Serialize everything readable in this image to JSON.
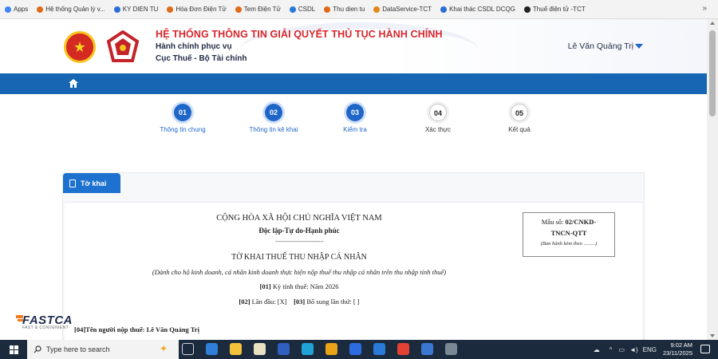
{
  "bookmarks_bar": {
    "items": [
      {
        "label": "Apps",
        "color": "#4285f4"
      },
      {
        "label": "Hệ thống Quản lý v...",
        "color": "#e06a1b"
      },
      {
        "label": "KY DIEN TU",
        "color": "#2a6fd6"
      },
      {
        "label": "Hóa Đơn Điện Tử",
        "color": "#e06a1b"
      },
      {
        "label": "Tem Điện Tử",
        "color": "#e06a1b"
      },
      {
        "label": "CSDL",
        "color": "#2a7bd6"
      },
      {
        "label": "Thu dien tu",
        "color": "#e06a1b"
      },
      {
        "label": "DataService-TCT",
        "color": "#e0881b"
      },
      {
        "label": "Khai thác CSDL DCQG",
        "color": "#2a6fd6"
      },
      {
        "label": "Thuế điện tử -TCT",
        "color": "#222222"
      }
    ],
    "more": "»"
  },
  "header": {
    "title": "HỆ THỐNG THÔNG TIN GIẢI QUYẾT THỦ TỤC HÀNH CHÍNH",
    "subtitle1": "Hành chính phục vụ",
    "subtitle2": "Cục Thuế - Bộ Tài chính",
    "user_name": "Lê Văn Quảng Trị",
    "emblem_glyph": "★"
  },
  "nav": {
    "home_icon": "home-icon"
  },
  "stepper": {
    "steps": [
      {
        "num": "01",
        "label": "Thông tin chung",
        "state": "done"
      },
      {
        "num": "02",
        "label": "Thông tin kê khai",
        "state": "done"
      },
      {
        "num": "03",
        "label": "Kiểm tra",
        "state": "done"
      },
      {
        "num": "04",
        "label": "Xác thực",
        "state": "todo"
      },
      {
        "num": "05",
        "label": "Kết quả",
        "state": "todo"
      }
    ]
  },
  "form": {
    "tab_label": "Tờ khai",
    "nation": "CỘNG HÒA XÃ HỘI CHỦ NGHĨA VIỆT NAM",
    "motto": "Độc lập-Tự do-Hạnh phúc",
    "divider": "----------------------------",
    "form_title": "TỜ KHAI THUẾ THU NHẬP CÁ NHÂN",
    "form_note": "(Dành cho hộ kinh doanh, cá nhân kinh doanh thực hiện nộp thuế thu nhập cá nhân trên thu nhập tính thuế)",
    "field01_code": "[01]",
    "field01_text": "Kỳ tính thuế: Năm 2026",
    "field02_code": "[02]",
    "field02_text": "Lần đầu: [X]",
    "field03_code": "[03]",
    "field03_text": "Bổ sung lần thứ: [ ]",
    "field04_code": "[04]",
    "field04_text": "Tên người nộp thuế: Lê Văn Quảng Trị",
    "mau_prefix": "Mẫu số:",
    "mau_code1": "02/CNKD-",
    "mau_code2": "TNCN-QTT",
    "mau_note": "(Ban hành kèm theo .........)"
  },
  "fastca": {
    "name": "FASTCA",
    "tagline": "FAST & CONVENIENT"
  },
  "taskbar": {
    "search_placeholder": "Type here to search",
    "tray_lang": "ENG",
    "time": "9:02 AM",
    "date": "23/11/2025",
    "app_icons": [
      {
        "name": "task-view-icon",
        "color": "#1b2a3d"
      },
      {
        "name": "app-icon-1",
        "color": "#2f7fd8"
      },
      {
        "name": "file-explorer-icon",
        "color": "#f3c23a"
      },
      {
        "name": "calendar-icon",
        "color": "#e9e2c2"
      },
      {
        "name": "app-icon-4",
        "color": "#2f5fbf"
      },
      {
        "name": "edge-icon",
        "color": "#1fa3d6"
      },
      {
        "name": "chrome-icon",
        "color": "#e9a319"
      },
      {
        "name": "app-icon-7",
        "color": "#2d6be0"
      },
      {
        "name": "app-icon-8",
        "color": "#2a7ad9"
      },
      {
        "name": "chrome-active-icon",
        "color": "#e44132"
      },
      {
        "name": "app-icon-10",
        "color": "#3a77d0"
      },
      {
        "name": "app-icon-11",
        "color": "#7a8896"
      }
    ]
  },
  "colors": {
    "brand_red": "#d8262c",
    "nav_blue": "#1766b3",
    "accent_blue": "#1e66c8"
  }
}
